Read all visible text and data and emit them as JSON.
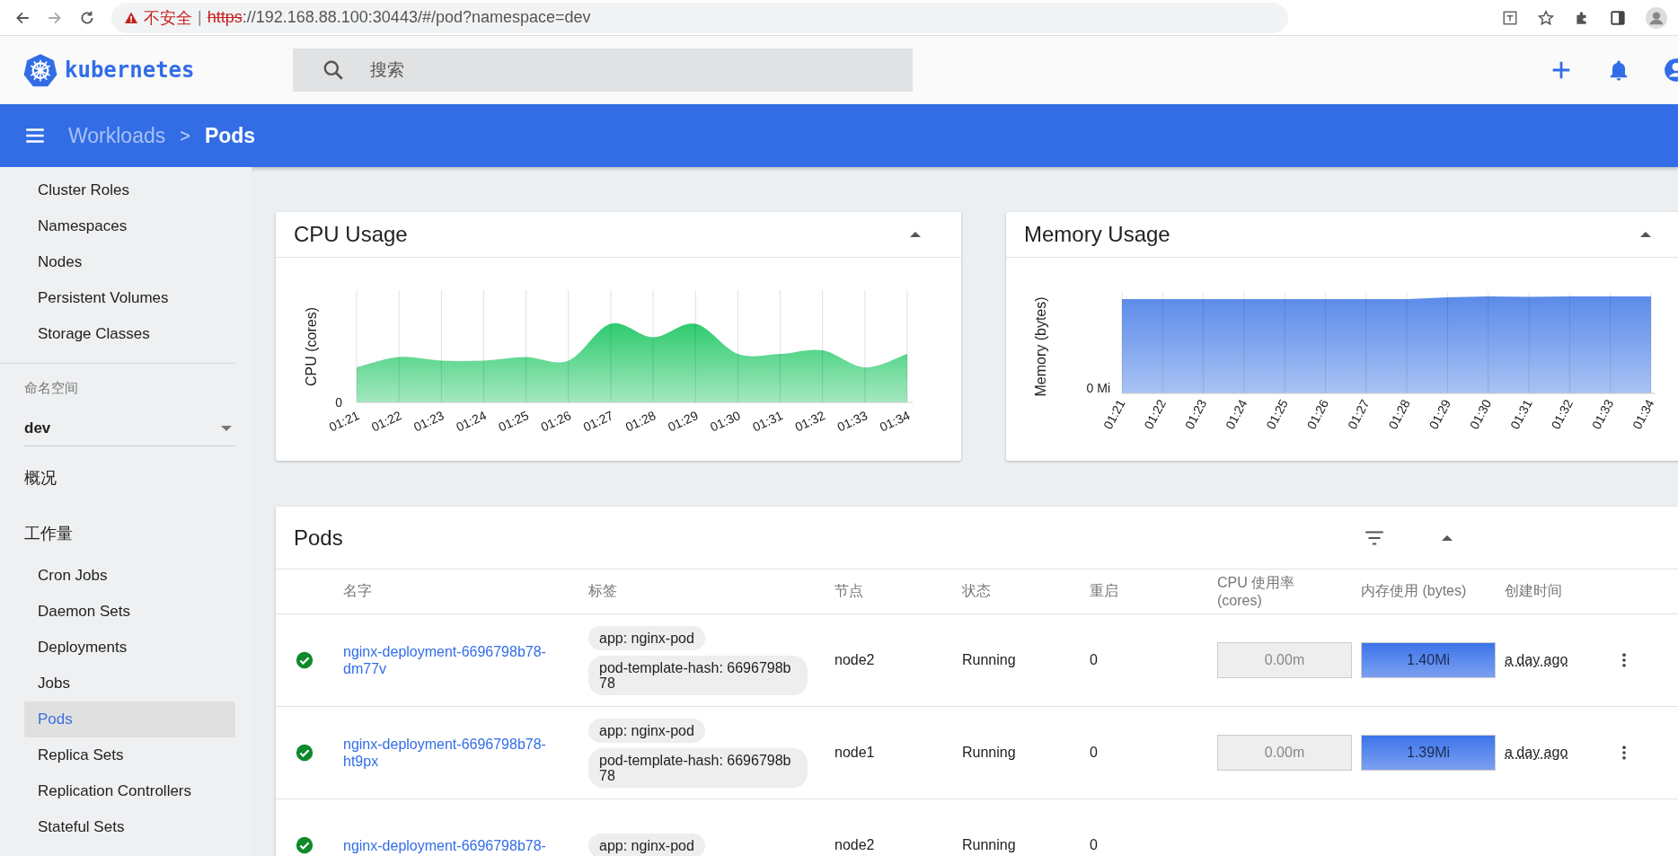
{
  "browser": {
    "security": "不安全",
    "separator": "|",
    "url_scheme": "https",
    "url_rest": "://192.168.88.100:30443/#/pod?namespace=dev"
  },
  "app_header": {
    "logo": "kubernetes",
    "search": {
      "placeholder": "搜索"
    }
  },
  "breadcrumb": {
    "parent": "Workloads",
    "separator": ">",
    "current": "Pods"
  },
  "sidebar": {
    "cluster_items": [
      {
        "label": "Cluster Roles",
        "selected": false
      },
      {
        "label": "Namespaces",
        "selected": false
      },
      {
        "label": "Nodes",
        "selected": false
      },
      {
        "label": "Persistent Volumes",
        "selected": false
      },
      {
        "label": "Storage Classes",
        "selected": false
      }
    ],
    "namespace": {
      "label": "命名空间",
      "value": "dev"
    },
    "sections": [
      {
        "label": "概况"
      },
      {
        "label": "工作量",
        "children": [
          {
            "label": "Cron Jobs",
            "selected": false
          },
          {
            "label": "Daemon Sets",
            "selected": false
          },
          {
            "label": "Deployments",
            "selected": false
          },
          {
            "label": "Jobs",
            "selected": false
          },
          {
            "label": "Pods",
            "selected": true
          },
          {
            "label": "Replica Sets",
            "selected": false
          },
          {
            "label": "Replication Controllers",
            "selected": false
          },
          {
            "label": "Stateful Sets",
            "selected": false
          }
        ]
      }
    ]
  },
  "cpu_card": {
    "title": "CPU Usage",
    "y_label": "CPU (cores)",
    "y_tick": "0",
    "x_labels": [
      "01:21",
      "01:22",
      "01:23",
      "01:24",
      "01:25",
      "01:26",
      "01:27",
      "01:28",
      "01:29",
      "01:30",
      "01:31",
      "01:32",
      "01:33",
      "01:34"
    ]
  },
  "memory_card": {
    "title": "Memory Usage",
    "y_label": "Memory (bytes)",
    "y_tick": "0 Mi",
    "x_labels": [
      "01:21",
      "01:22",
      "01:23",
      "01:24",
      "01:25",
      "01:26",
      "01:27",
      "01:28",
      "01:29",
      "01:30",
      "01:31",
      "01:32",
      "01:33",
      "01:34"
    ]
  },
  "pods": {
    "title": "Pods",
    "columns": [
      "名字",
      "标签",
      "节点",
      "状态",
      "重启",
      "CPU 使用率 (cores)",
      "内存使用 (bytes)",
      "创建时间"
    ],
    "rows": [
      {
        "name": "nginx-deployment-6696798b78-dm77v",
        "labels": [
          "app: nginx-pod",
          "pod-template-hash: 6696798b78"
        ],
        "node": "node2",
        "status": "Running",
        "restarts": "0",
        "cpu": {
          "reading": "0.00m",
          "level": 0
        },
        "memory": {
          "reading": "1.40Mi",
          "level": 1
        },
        "created": "a day ago"
      },
      {
        "name": "nginx-deployment-6696798b78-ht9px",
        "labels": [
          "app: nginx-pod",
          "pod-template-hash: 6696798b78"
        ],
        "node": "node1",
        "status": "Running",
        "restarts": "0",
        "cpu": {
          "reading": "0.00m",
          "level": 0
        },
        "memory": {
          "reading": "1.39Mi",
          "level": 1
        },
        "created": "a day ago"
      },
      {
        "name": "nginx-deployment-6696798b78-",
        "labels": [
          "app: nginx-pod"
        ],
        "node": "node2",
        "status": "Running",
        "restarts": "0"
      }
    ]
  }
}
